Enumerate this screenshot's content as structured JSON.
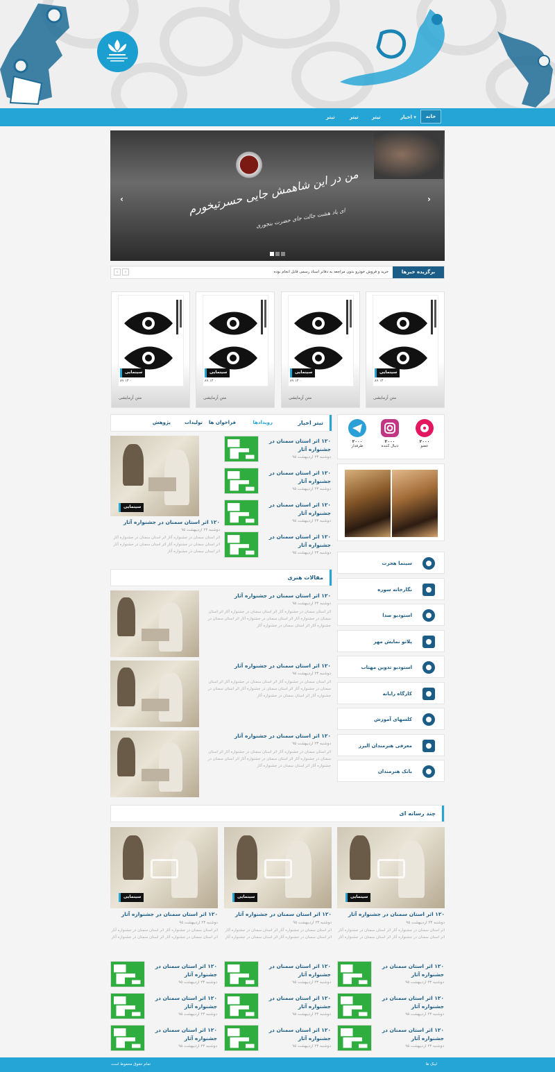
{
  "colors": {
    "accent": "#25a4d6",
    "dark_blue": "#1b5d86",
    "green": "#2fae3f"
  },
  "nav": {
    "items": [
      "خانه",
      "اخبار",
      "تیتر",
      "تیتر",
      "تیتر"
    ]
  },
  "slider": {
    "calligraphy_main": "من در این شاهمش جایی حسرتیخورم",
    "calligraphy_sub": "ای یاد هشت جالت جای حضرت بنجوری",
    "slide_count": 3,
    "active_slide": 1
  },
  "ticker": {
    "label": "برگزیده خبرها",
    "text": "خرید و فروش خودرو بدون مراجعه به دفاتر اسناد رسمی قابل انجام بوده"
  },
  "cards": [
    {
      "category": "سینمایی",
      "date": "۸۹ ۱۳ ۰",
      "caption": "متن آزمایشی"
    },
    {
      "category": "سینمایی",
      "date": "۸۹ ۱۳ ۰",
      "caption": "متن آزمایشی"
    },
    {
      "category": "سینمایی",
      "date": "۸۹ ۱۳ ۰",
      "caption": "متن آزمایشی"
    },
    {
      "category": "سینمایی",
      "date": "۸۹ ۱۳ ۰",
      "caption": "متن آزمایشی"
    }
  ],
  "social": [
    {
      "count": "۲۰۰۰",
      "label": "عضو",
      "icon": "film-reel-icon",
      "color": "#e2175f"
    },
    {
      "count": "۲۰۰۰",
      "label": "دنبال کننده",
      "icon": "instagram-icon",
      "color": "#c13584"
    },
    {
      "count": "۲۰۰۰",
      "label": "طرفدار",
      "icon": "telegram-icon",
      "color": "#2a9fd8"
    }
  ],
  "news_tabs": {
    "title": "تیتر اخبار",
    "tabs": [
      "رویدادها",
      "فراخوان ها",
      "تولیدات",
      "پژوهش"
    ],
    "active": 0
  },
  "news_featured": {
    "category": "سینمایی",
    "title": "۱۲۰ اثر استان سمنان در جشنواره آثار",
    "date": "دوشنبه ۲۳ اردیبهشت ۹۵",
    "body": "اثر استان سمنان در جشنواره آثار اثر استان سمنان در جشنواره آثار اثر استان سمنان در جشنواره آثار اثر استان سمنان در جشنواره آثار اثر استان سمنان در جشنواره آثار"
  },
  "news_list": [
    {
      "title": "۱۲۰ اثر استان سمنان در جشنواره آثار",
      "date": "دوشنبه ۲۳ اردیبهشت ۹۵"
    },
    {
      "title": "۱۲۰ اثر استان سمنان در جشنواره آثار",
      "date": "دوشنبه ۲۳ اردیبهشت ۹۵"
    },
    {
      "title": "۱۲۰ اثر استان سمنان در جشنواره آثار",
      "date": "دوشنبه ۲۳ اردیبهشت ۹۵"
    },
    {
      "title": "۱۲۰ اثر استان سمنان در جشنواره آثار",
      "date": "دوشنبه ۲۳ اردیبهشت ۹۵"
    }
  ],
  "articles": {
    "title": "مقالات هنری",
    "items": [
      {
        "title": "۱۲۰ اثر استان سمنان در جشنواره آثار",
        "date": "دوشنبه ۲۳ اردیبهشت ۹۵",
        "body": "اثر استان سمنان در جشنواره آثار اثر استان سمنان در جشنواره آثار اثر استان سمنان در جشنواره آثار اثر استان سمنان در جشنواره آثار اثر استان سمنان در جشنواره آثار اثر استان سمنان در جشنواره آثار"
      },
      {
        "title": "۱۲۰ اثر استان سمنان در جشنواره آثار",
        "date": "دوشنبه ۲۳ اردیبهشت ۹۵",
        "body": "اثر استان سمنان در جشنواره آثار اثر استان سمنان در جشنواره آثار اثر استان سمنان در جشنواره آثار اثر استان سمنان در جشنواره آثار اثر استان سمنان در جشنواره آثار اثر استان سمنان در جشنواره آثار"
      },
      {
        "title": "۱۲۰ اثر استان سمنان در جشنواره آثار",
        "date": "دوشنبه ۲۳ اردیبهشت ۹۵",
        "body": "اثر استان سمنان در جشنواره آثار اثر استان سمنان در جشنواره آثار اثر استان سمنان در جشنواره آثار اثر استان سمنان در جشنواره آثار اثر استان سمنان در جشنواره آثار اثر استان سمنان در جشنواره آثار"
      }
    ]
  },
  "services": [
    {
      "label": "سینما هجرت",
      "icon": "film-reel-icon"
    },
    {
      "label": "نگارخانه سوره",
      "icon": "gallery-arch-icon"
    },
    {
      "label": "استودیو صدا",
      "icon": "microphone-icon"
    },
    {
      "label": "پلاتو نمایش مهر",
      "icon": "theater-masks-icon"
    },
    {
      "label": "استودیو تدوین مهتاب",
      "icon": "film-strip-icon"
    },
    {
      "label": "کارگاه رایانه",
      "icon": "computer-icon"
    },
    {
      "label": "کلسهای آموزش",
      "icon": "teacher-icon"
    },
    {
      "label": "معرفی هنرمندان البرز",
      "icon": "person-icon"
    },
    {
      "label": "بانک هنرمندان",
      "icon": "group-icon"
    }
  ],
  "multimedia": {
    "title": "چند رسانه ای",
    "cards": [
      {
        "category": "سینمایی",
        "title": "۱۲۰ اثر استان سمنان در جشنواره آثار",
        "date": "دوشنبه ۲۳ اردیبهشت ۹۵",
        "body": "اثر استان سمنان در جشنواره آثار اثر استان سمنان در جشنواره آثار اثر استان سمنان در جشنواره آثار اثر استان سمنان در جشنواره آثار"
      },
      {
        "category": "سینمایی",
        "title": "۱۲۰ اثر استان سمنان در جشنواره آثار",
        "date": "دوشنبه ۲۳ اردیبهشت ۹۵",
        "body": "اثر استان سمنان در جشنواره آثار اثر استان سمنان در جشنواره آثار اثر استان سمنان در جشنواره آثار اثر استان سمنان در جشنواره آثار"
      },
      {
        "category": "سینمایی",
        "title": "۱۲۰ اثر استان سمنان در جشنواره آثار",
        "date": "دوشنبه ۲۳ اردیبهشت ۹۵",
        "body": "اثر استان سمنان در جشنواره آثار اثر استان سمنان در جشنواره آثار اثر استان سمنان در جشنواره آثار اثر استان سمنان در جشنواره آثار"
      }
    ],
    "list": [
      {
        "title": "۱۲۰ اثر استان سمنان در جشنواره آثار",
        "date": "دوشنبه ۲۳ اردیبهشت ۹۵"
      },
      {
        "title": "۱۲۰ اثر استان سمنان در جشنواره آثار",
        "date": "دوشنبه ۲۳ اردیبهشت ۹۵"
      },
      {
        "title": "۱۲۰ اثر استان سمنان در جشنواره آثار",
        "date": "دوشنبه ۲۳ اردیبهشت ۹۵"
      }
    ]
  },
  "footer": {
    "right": "لینک ها",
    "left": "تمام حقوق محفوظ است"
  }
}
